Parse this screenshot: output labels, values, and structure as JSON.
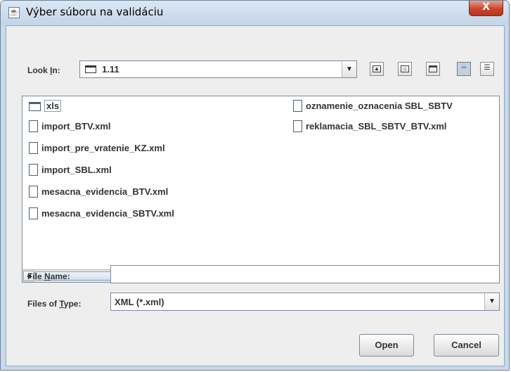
{
  "window": {
    "title": "Výber súboru na validáciu",
    "close_glyph": "X"
  },
  "look_in": {
    "label_pre": "Look ",
    "label_mnemonic": "I",
    "label_post": "n:",
    "value": "1.11"
  },
  "toolbar": {
    "buttons": [
      "up-one-level",
      "home",
      "new-folder",
      "list-view",
      "details-view"
    ]
  },
  "files": {
    "column1": [
      {
        "name": "xls",
        "type": "folder"
      },
      {
        "name": "import_BTV.xml",
        "type": "file"
      },
      {
        "name": "import_pre_vratenie_KZ.xml",
        "type": "file"
      },
      {
        "name": "import_SBL.xml",
        "type": "file"
      },
      {
        "name": "mesacna_evidencia_BTV.xml",
        "type": "file"
      },
      {
        "name": "mesacna_evidencia_SBTV.xml",
        "type": "file"
      }
    ],
    "column2": [
      {
        "name": "oznamenie_oznacenia SBL_SBTV",
        "type": "file"
      },
      {
        "name": "reklamacia_SBL_SBTV_BTV.xml",
        "type": "file"
      }
    ]
  },
  "file_name": {
    "label_pre": "File ",
    "label_mnemonic": "N",
    "label_post": "ame:",
    "value": ""
  },
  "file_type": {
    "label_pre": "Files of ",
    "label_mnemonic": "T",
    "label_post": "ype:",
    "value": "XML (*.xml)"
  },
  "buttons": {
    "open": "Open",
    "cancel": "Cancel"
  },
  "colors": {
    "frame": "#c9d9ea",
    "close": "#c9452c",
    "panel": "#eeeeee"
  }
}
